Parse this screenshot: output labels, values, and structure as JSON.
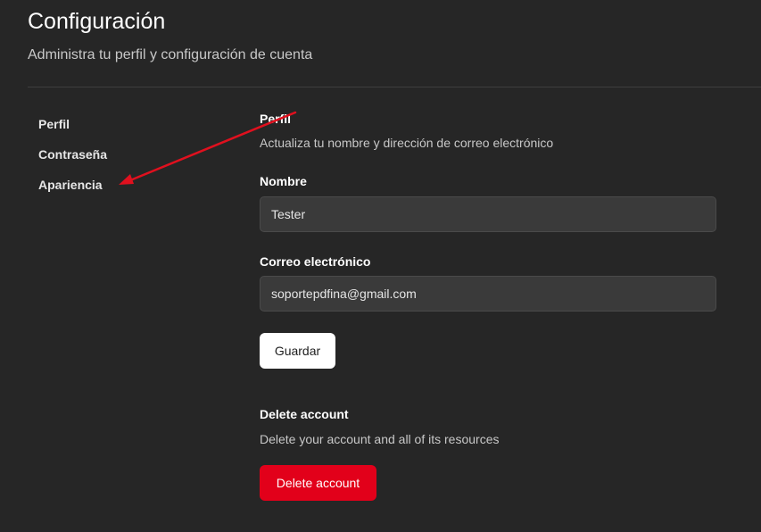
{
  "header": {
    "title": "Configuración",
    "subtitle": "Administra tu perfil y configuración de cuenta"
  },
  "sidebar": {
    "items": [
      {
        "label": "Perfil"
      },
      {
        "label": "Contraseña"
      },
      {
        "label": "Apariencia"
      }
    ]
  },
  "profile": {
    "title": "Perfil",
    "description": "Actualiza tu nombre y dirección de correo electrónico",
    "name_label": "Nombre",
    "name_value": "Tester",
    "email_label": "Correo electrónico",
    "email_value": "soportepdfina@gmail.com",
    "save_label": "Guardar"
  },
  "delete_section": {
    "title": "Delete account",
    "description": "Delete your account and all of its resources",
    "button_label": "Delete account"
  },
  "colors": {
    "background": "#262626",
    "danger": "#e2001a",
    "annotation_arrow": "#e0101e"
  }
}
